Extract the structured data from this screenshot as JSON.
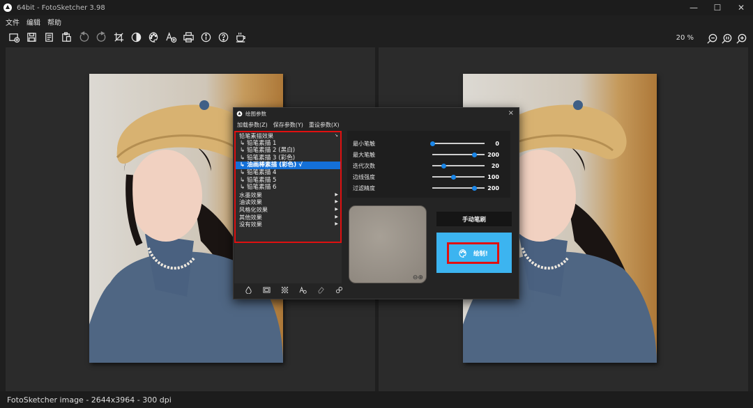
{
  "window": {
    "title": "64bit - FotoSketcher 3.98",
    "minimize_icon": "minimize-icon",
    "maximize_icon": "maximize-icon",
    "close_icon": "close-icon"
  },
  "menu": [
    "文件",
    "编辑",
    "帮助"
  ],
  "toolbar": {
    "icons": [
      "open-image-icon",
      "save-icon",
      "copy-icon",
      "paste-icon",
      "undo-icon",
      "redo-icon",
      "crop-icon",
      "contrast-icon",
      "palette-icon",
      "add-text-icon",
      "print-icon",
      "info-icon",
      "help-icon",
      "coffee-icon"
    ],
    "zoom_level": "20 %",
    "zoom_icons": [
      "zoom-out-icon",
      "zoom-reset-icon",
      "zoom-in-icon"
    ]
  },
  "status": {
    "text": "FotoSketcher image - 2644x3964 - 300 dpi"
  },
  "dialog": {
    "title": "绘图参数",
    "close": "×",
    "menu": [
      "加载参数(Z)",
      "保存参数(Y)",
      "重设参数(X)"
    ],
    "effects": {
      "group_header": "铅笔素描效果",
      "items": [
        "铅笔素描 1",
        "铅笔素描 2 (黑白)",
        "铅笔素描 3 (彩色)",
        "油画棒素描 (彩色) √",
        "铅笔素描 4",
        "铅笔素描 5",
        "铅笔素描 6"
      ],
      "selected_index": 3,
      "groups": [
        "水墨效果",
        "油读效果",
        "风格化效果",
        "其他效果",
        "没有效果"
      ]
    },
    "bottom_icons": [
      "water-drop-icon",
      "frame-icon",
      "texture-icon",
      "text-effect-icon",
      "eraser-icon",
      "link-icon"
    ],
    "params": [
      {
        "label": "最小笔触",
        "value": "0",
        "level": 0.0
      },
      {
        "label": "最大笔触",
        "value": "200",
        "level": 0.8
      },
      {
        "label": "迭代次数",
        "value": "20",
        "level": 0.22
      },
      {
        "label": "边线强度",
        "value": "100",
        "level": 0.4
      },
      {
        "label": "过滤精度",
        "value": "200",
        "level": 0.8
      }
    ],
    "preview_zoom_icon": "preview-zoom-icon",
    "manual_button": "手动笔刷",
    "draw_button": "绘制!",
    "colors": {
      "accent": "#1470d8",
      "draw_bg": "#3cb4f0",
      "highlight": "#e01010"
    }
  }
}
